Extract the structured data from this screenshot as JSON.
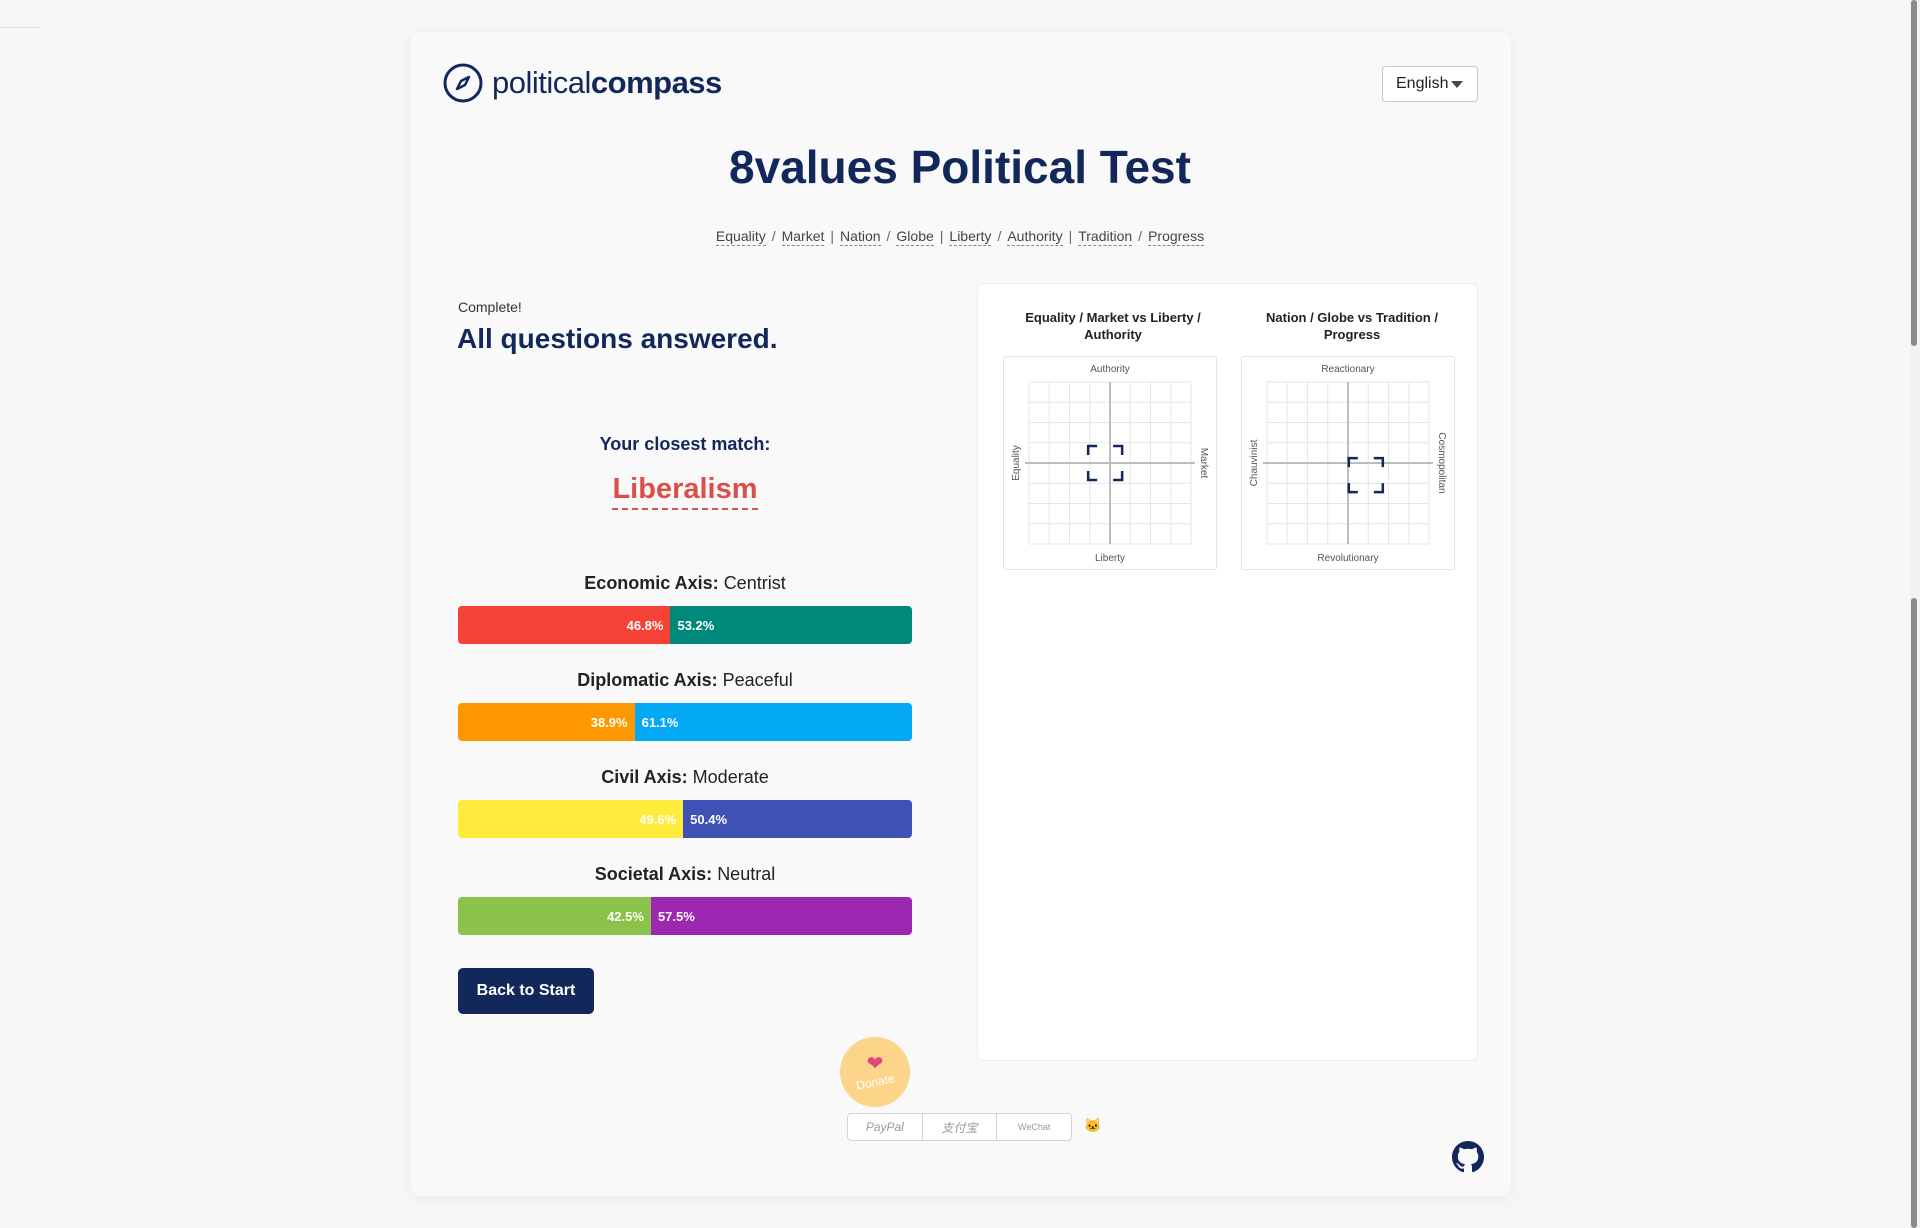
{
  "header": {
    "logo_bold": "political",
    "logo_light": "compass",
    "language": "English"
  },
  "title": "8values Political Test",
  "axis_links": [
    "Equality",
    "Market",
    "Nation",
    "Globe",
    "Liberty",
    "Authority",
    "Tradition",
    "Progress"
  ],
  "status": {
    "label": "Complete!",
    "heading": "All questions answered."
  },
  "match": {
    "label": "Your closest match:",
    "ideology": "Liberalism"
  },
  "axes": [
    {
      "name": "Economic Axis:",
      "category": "Centrist",
      "left_label": "46.8%",
      "right_label": "53.2%",
      "left_pct": 46.8,
      "left_color": "#f44336",
      "right_color": "#00897b"
    },
    {
      "name": "Diplomatic Axis:",
      "category": "Peaceful",
      "left_label": "38.9%",
      "right_label": "61.1%",
      "left_pct": 38.9,
      "left_color": "#ff9800",
      "right_color": "#03a9f4"
    },
    {
      "name": "Civil Axis:",
      "category": "Moderate",
      "left_label": "49.6%",
      "right_label": "50.4%",
      "left_pct": 49.6,
      "left_color": "#ffeb3b",
      "right_color": "#3f51b5"
    },
    {
      "name": "Societal Axis:",
      "category": "Neutral",
      "left_label": "42.5%",
      "right_label": "57.5%",
      "left_pct": 42.5,
      "left_color": "#8bc34a",
      "right_color": "#9c27b0"
    }
  ],
  "back_button": "Back to Start",
  "charts": [
    {
      "title": "Equality / Market vs Liberty / Authority",
      "top": "Authority",
      "bottom": "Liberty",
      "left": "Equality",
      "right": "Market",
      "marker_x": -0.06,
      "marker_y": 0.0
    },
    {
      "title": "Nation / Globe vs Tradition / Progress",
      "top": "Reactionary",
      "bottom": "Revolutionary",
      "left": "Chauvinist",
      "right": "Cosmopolitan",
      "marker_x": 0.22,
      "marker_y": -0.15
    }
  ],
  "donate": {
    "label": "Donate",
    "methods": [
      "PayPal",
      "支付宝",
      "WeChat"
    ]
  },
  "icons": {
    "logo": "compass-icon",
    "caret": "chevron-down-icon",
    "heart": "heart-icon",
    "cat": "cat-icon",
    "github": "github-icon"
  }
}
